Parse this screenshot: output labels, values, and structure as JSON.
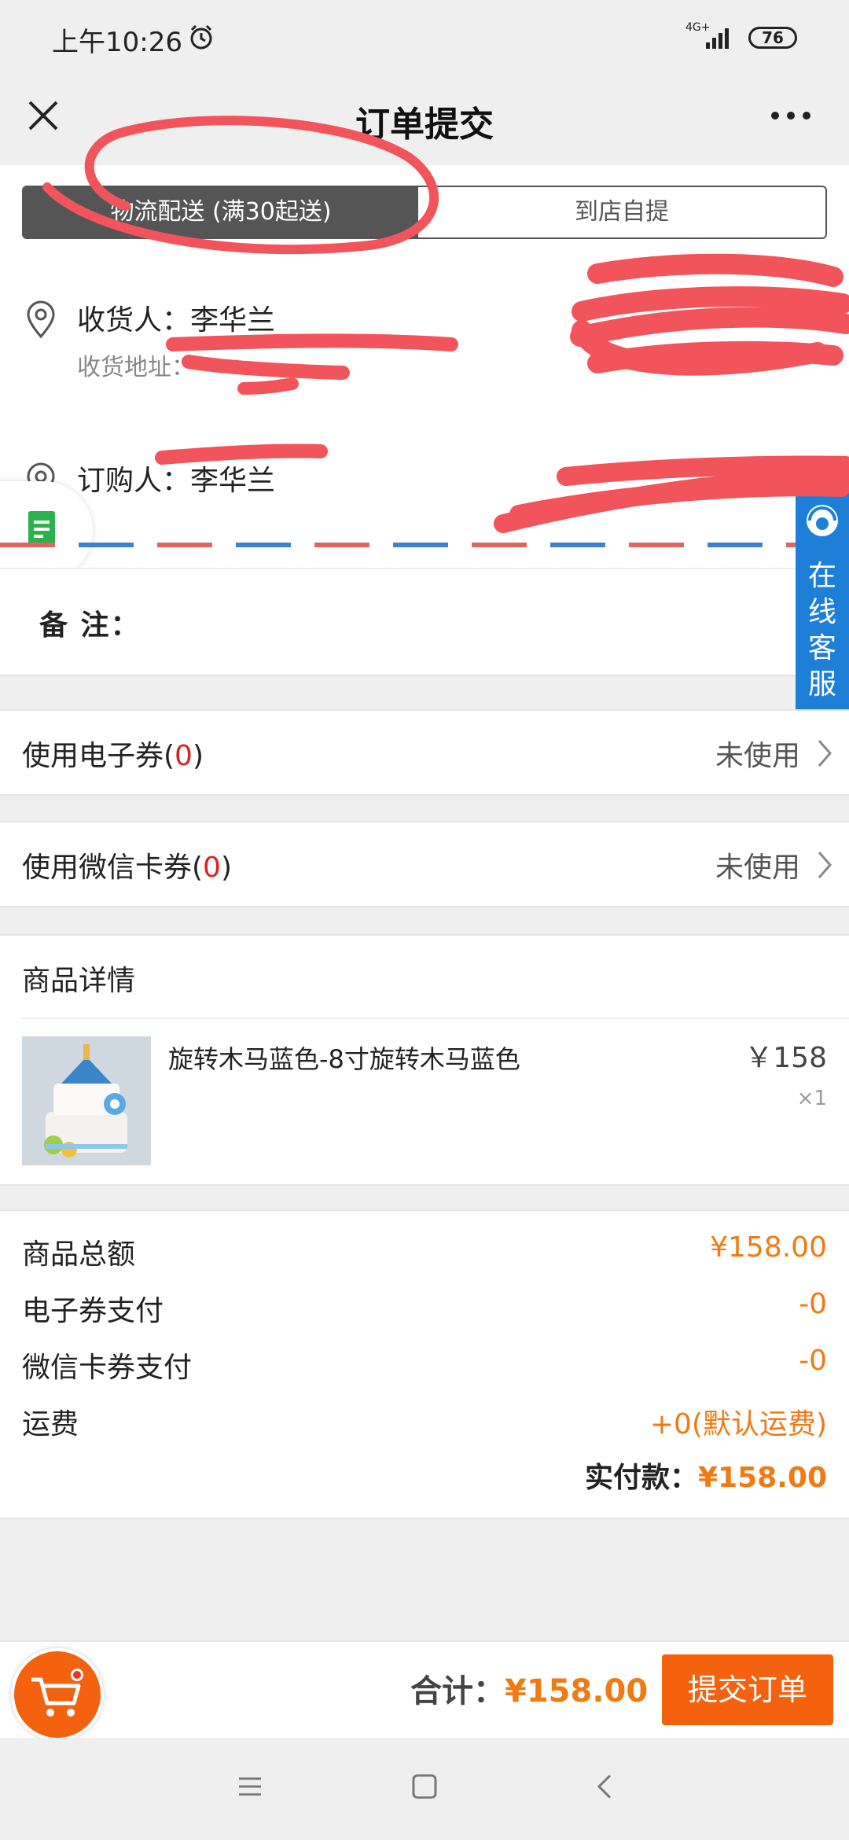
{
  "status_bar": {
    "time": "上午10:26",
    "network": "4G+",
    "battery": "76"
  },
  "header": {
    "title": "订单提交"
  },
  "delivery": {
    "active_tab": "物流配送 (满30起送)",
    "inactive_tab": "到店自提"
  },
  "receiver": {
    "label": "收货人：李华兰",
    "address_label": "收货地址："
  },
  "buyer": {
    "label": "订购人：李华兰"
  },
  "remark": {
    "label": "备    注："
  },
  "customer_service": {
    "label": "在线客服"
  },
  "coupons": [
    {
      "label": "使用电子券(",
      "count": "0",
      "suffix": ")",
      "value": "未使用"
    },
    {
      "label": "使用微信卡券(",
      "count": "0",
      "suffix": ")",
      "value": "未使用"
    }
  ],
  "goods": {
    "header": "商品详情",
    "item": {
      "name": "旋转木马蓝色-8寸旋转木马蓝色",
      "price": "￥158",
      "quantity": "×1"
    }
  },
  "summary": {
    "rows": [
      {
        "label": "商品总额",
        "value": "¥158.00"
      },
      {
        "label": "电子券支付",
        "value": "-0"
      },
      {
        "label": "微信卡券支付",
        "value": "-0"
      },
      {
        "label": "运费",
        "value": "+0(默认运费)"
      }
    ],
    "paid_label": "实付款：",
    "paid_amount": "¥158.00"
  },
  "bottom_bar": {
    "total_label": "合计：",
    "total_amount": "¥158.00",
    "submit_label": "提交订单"
  },
  "colors": {
    "accent": "#f07a14",
    "button": "#f5620f",
    "service": "#1e7fd8",
    "annotation": "#f2545b"
  }
}
